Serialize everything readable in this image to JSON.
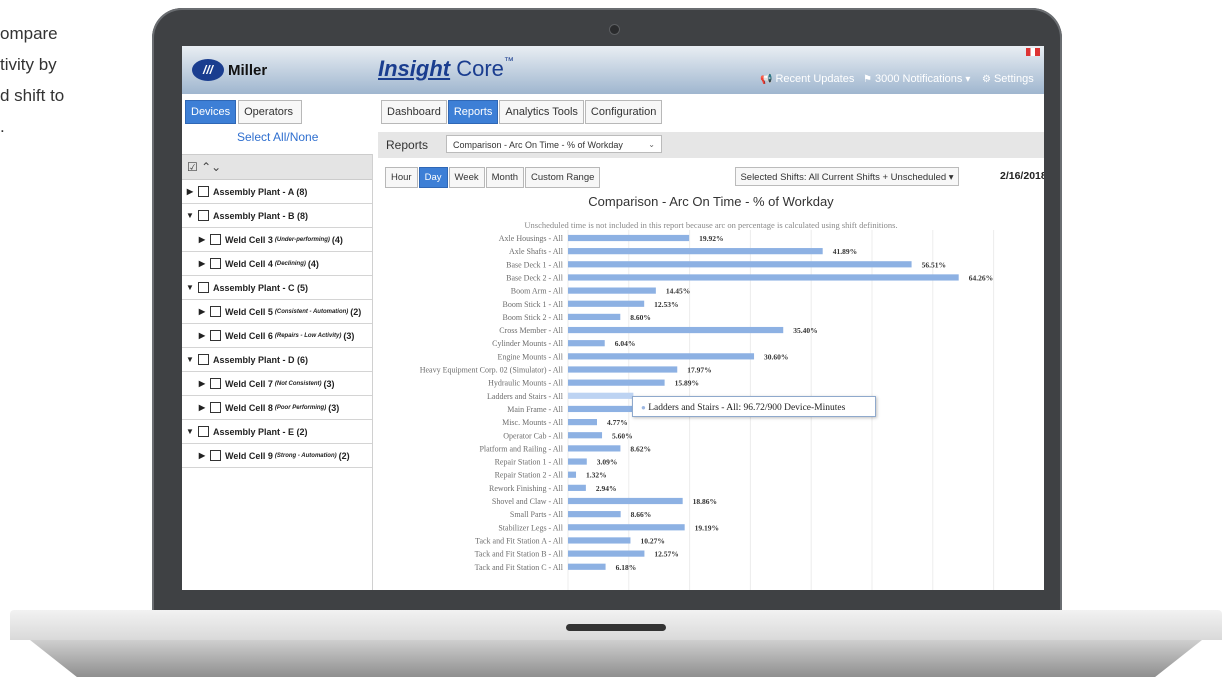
{
  "side_text": [
    "ompare",
    "tivity by",
    "d shift to",
    "."
  ],
  "topbar": {
    "logo_mark": "///",
    "logo_text": "Miller",
    "brand_bold": "Insight",
    "brand_rest": " Core",
    "brand_tm": "™",
    "recent_updates": "Recent Updates",
    "notifications": "3000 Notifications",
    "settings": "Settings"
  },
  "left_tabs": {
    "devices": "Devices",
    "operators": "Operators"
  },
  "main_tabs": {
    "dashboard": "Dashboard",
    "reports": "Reports",
    "analytics": "Analytics Tools",
    "configuration": "Configuration"
  },
  "select_all": "Select All/None",
  "tree_header": "☑ ⌃⌄",
  "tree": [
    {
      "arrow": "▶",
      "label": "Assembly Plant - A (8)",
      "sub": "",
      "count": "",
      "level": 0
    },
    {
      "arrow": "▼",
      "label": "Assembly Plant - B (8)",
      "sub": "",
      "count": "",
      "level": 0
    },
    {
      "arrow": "▶",
      "label": "Weld Cell 3",
      "sub": "(Under-performing)",
      "count": "(4)",
      "level": 1
    },
    {
      "arrow": "▶",
      "label": "Weld Cell 4",
      "sub": "(Declining)",
      "count": "(4)",
      "level": 1
    },
    {
      "arrow": "▼",
      "label": "Assembly Plant - C (5)",
      "sub": "",
      "count": "",
      "level": 0
    },
    {
      "arrow": "▶",
      "label": "Weld Cell 5",
      "sub": "(Consistent - Automation)",
      "count": "(2)",
      "level": 1
    },
    {
      "arrow": "▶",
      "label": "Weld Cell 6",
      "sub": "(Repairs - Low Activity)",
      "count": "(3)",
      "level": 1
    },
    {
      "arrow": "▼",
      "label": "Assembly Plant - D (6)",
      "sub": "",
      "count": "",
      "level": 0
    },
    {
      "arrow": "▶",
      "label": "Weld Cell 7",
      "sub": "(Not Consistent)",
      "count": "(3)",
      "level": 1
    },
    {
      "arrow": "▶",
      "label": "Weld Cell 8",
      "sub": "(Poor Performing)",
      "count": "(3)",
      "level": 1
    },
    {
      "arrow": "▼",
      "label": "Assembly Plant - E (2)",
      "sub": "",
      "count": "",
      "level": 0
    },
    {
      "arrow": "▶",
      "label": "Weld Cell 9",
      "sub": "(Strong - Automation)",
      "count": "(2)",
      "level": 1
    }
  ],
  "reports": {
    "label": "Reports",
    "selected": "Comparison - Arc On Time - % of Workday"
  },
  "range": [
    "Hour",
    "Day",
    "Week",
    "Month",
    "Custom Range"
  ],
  "range_active": "Day",
  "shifts": "Selected Shifts: All Current Shifts + Unscheduled ▾",
  "date": "2/16/2018",
  "tooltip": {
    "dot": "●",
    "text": "Ladders and Stairs - All: 96.72/900 Device-Minutes"
  },
  "chart_data": {
    "type": "bar",
    "orientation": "horizontal",
    "title": "Comparison - Arc On Time - % of Workday",
    "subtitle": "Unscheduled time is not included in this report because arc on percentage is calculated using shift definitions.",
    "bar_color": "#8db1e3",
    "highlight_color": "#bdd3f2",
    "highlighted": "Ladders and Stairs - All",
    "grid": true,
    "categories": [
      "Axle Housings - All",
      "Axle Shafts - All",
      "Base Deck 1 - All",
      "Base Deck 2 - All",
      "Boom Arm - All",
      "Boom Stick 1 - All",
      "Boom Stick 2 - All",
      "Cross Member - All",
      "Cylinder Mounts - All",
      "Engine Mounts - All",
      "Heavy Equipment Corp. 02 (Simulator) - All",
      "Hydraulic Mounts - All",
      "Ladders and Stairs - All",
      "Main Frame - All",
      "Misc. Mounts - All",
      "Operator Cab - All",
      "Platform and Railing - All",
      "Repair Station 1 - All",
      "Repair Station 2 - All",
      "Rework Finishing - All",
      "Shovel and Claw - All",
      "Small Parts - All",
      "Stabilizer Legs - All",
      "Tack and Fit Station A - All",
      "Tack and Fit Station B - All",
      "Tack and Fit Station C - All"
    ],
    "values": [
      19.92,
      41.89,
      56.51,
      64.26,
      14.45,
      12.53,
      8.6,
      35.4,
      6.04,
      30.6,
      17.97,
      15.89,
      10.75,
      17.89,
      4.77,
      5.6,
      8.62,
      3.09,
      1.32,
      2.94,
      18.86,
      8.66,
      19.19,
      10.27,
      12.57,
      6.18
    ],
    "labels": [
      "19.92%",
      "41.89%",
      "56.51%",
      "64.26%",
      "14.45%",
      "12.53%",
      "8.60%",
      "35.40%",
      "6.04%",
      "30.60%",
      "17.97%",
      "15.89%",
      "",
      "17.89%",
      "4.77%",
      "5.60%",
      "8.62%",
      "3.09%",
      "1.32%",
      "2.94%",
      "18.86%",
      "8.66%",
      "19.19%",
      "10.27%",
      "12.57%",
      "6.18%"
    ],
    "xlim": [
      0,
      100
    ]
  }
}
